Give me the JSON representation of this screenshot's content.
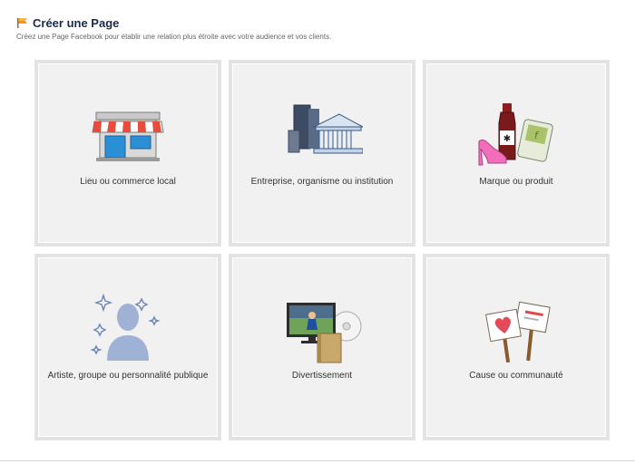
{
  "header": {
    "title": "Créer une Page",
    "subtitle": "Créez une Page Facebook pour établir une relation plus étroite avec votre audience et vos clients."
  },
  "categories": [
    {
      "label": "Lieu ou commerce local",
      "icon": "storefront-icon"
    },
    {
      "label": "Entreprise, organisme ou institution",
      "icon": "buildings-icon"
    },
    {
      "label": "Marque ou produit",
      "icon": "products-icon"
    },
    {
      "label": "Artiste, groupe ou personnalité publique",
      "icon": "person-silhouette-icon"
    },
    {
      "label": "Divertissement",
      "icon": "entertainment-icon"
    },
    {
      "label": "Cause ou communauté",
      "icon": "protest-signs-icon"
    }
  ],
  "colors": {
    "title": "#1c2a47",
    "tile_background": "#f1f1f1",
    "tile_border": "#e3e3e3",
    "flag": "#f7931e"
  }
}
